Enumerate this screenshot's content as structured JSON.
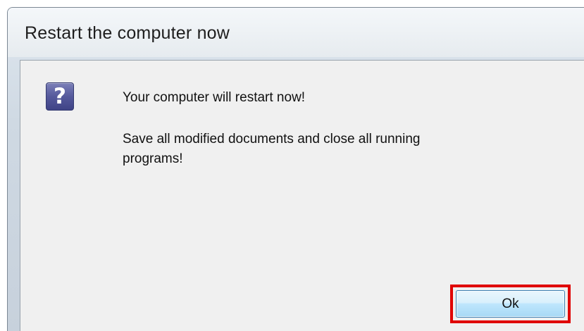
{
  "dialog": {
    "title": "Restart the computer now",
    "icon": "question-icon",
    "icon_glyph": "?",
    "message_line1": "Your computer will restart now!",
    "message_line2": "Save all modified documents and close all running",
    "message_line3": "programs!",
    "ok_label": "Ok"
  },
  "colors": {
    "highlight": "#e00000",
    "button_fill": "#bee6fd",
    "dialog_background": "#f0f0f0",
    "icon_fill": "#55599c"
  }
}
